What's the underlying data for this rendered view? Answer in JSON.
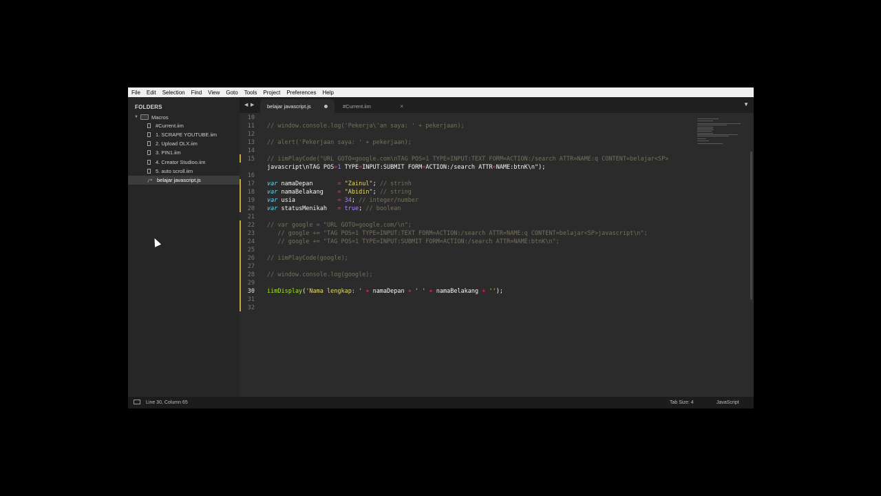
{
  "menu": [
    "File",
    "Edit",
    "Selection",
    "Find",
    "View",
    "Goto",
    "Tools",
    "Project",
    "Preferences",
    "Help"
  ],
  "sidebar": {
    "header": "FOLDERS",
    "root": "Macros",
    "files": [
      "#Current.iim",
      "1. SCRAPE YOUTUBE.iim",
      "2. Upload OLX.iim",
      "3. PIN1.iim",
      "4. Creator Studioo.iim",
      "5. auto scroll.iim",
      "belajar javascript.js"
    ],
    "active_index": 6,
    "active_icon": "/*"
  },
  "tabs": [
    {
      "label": "belajar javascript.js",
      "active": true,
      "dirty": true
    },
    {
      "label": "#Current.iim",
      "active": false,
      "close": "×"
    }
  ],
  "editor": {
    "lines": [
      {
        "n": "10",
        "t": ""
      },
      {
        "n": "11",
        "t": "// window.console.log('Pekerja\\'an saya: ' + pekerjaan);"
      },
      {
        "n": "12",
        "t": ""
      },
      {
        "n": "13",
        "t": "// alert('Pekerjaan saya: ' + pekerjaan);"
      },
      {
        "n": "14",
        "t": ""
      },
      {
        "n": "15",
        "t": "// iimPlayCode(\"URL GOTO=google.com\\nTAG POS=1 TYPE=INPUT:TEXT FORM=ACTION:/search ATTR=NAME:q CONTENT=belajar<SP>"
      },
      {
        "n": "",
        "t": "javascript\\nTAG POS=1 TYPE=INPUT:SUBMIT FORM=ACTION:/search ATTR=NAME:btnK\\n\");"
      },
      {
        "n": "16",
        "t": ""
      },
      {
        "n": "17",
        "t": "var namaDepan       = \"Zainul\"; // strinh"
      },
      {
        "n": "18",
        "t": "var namaBelakang    = \"Abidin\"; // string"
      },
      {
        "n": "19",
        "t": "var usia            = 34; // integer/number"
      },
      {
        "n": "20",
        "t": "var statusMenikah   = true; // boolean"
      },
      {
        "n": "21",
        "t": ""
      },
      {
        "n": "22",
        "t": "// var google = \"URL GOTO=google.com/\\n\";"
      },
      {
        "n": "23",
        "t": "   // google += \"TAG POS=1 TYPE=INPUT:TEXT FORM=ACTION:/search ATTR=NAME:q CONTENT=belajar<SP>javascript\\n\";"
      },
      {
        "n": "24",
        "t": "   // google += \"TAG POS=1 TYPE=INPUT:SUBMIT FORM=ACTION:/search ATTR=NAME:btnK\\n\";"
      },
      {
        "n": "25",
        "t": ""
      },
      {
        "n": "26",
        "t": "// iimPlayCode(google);"
      },
      {
        "n": "27",
        "t": ""
      },
      {
        "n": "28",
        "t": "// window.console.log(google);"
      },
      {
        "n": "29",
        "t": ""
      },
      {
        "n": "30",
        "t": "iimDisplay('Nama lengkap: ' + namaDepan + ' ' + namaBelakang + '');"
      },
      {
        "n": "31",
        "t": ""
      },
      {
        "n": "32",
        "t": ""
      }
    ],
    "current_line": "30"
  },
  "statusbar": {
    "position": "Line 30, Column 65",
    "tab_size": "Tab Size: 4",
    "syntax": "JavaScript"
  },
  "colors": {
    "background": "#262626",
    "editor_bg": "#2b2b2b",
    "modified_marker": "#c9a83a",
    "comment": "#75715e",
    "string": "#e6db74",
    "keyword": "#66d9ef",
    "number": "#ae81ff",
    "operator": "#f92672"
  }
}
